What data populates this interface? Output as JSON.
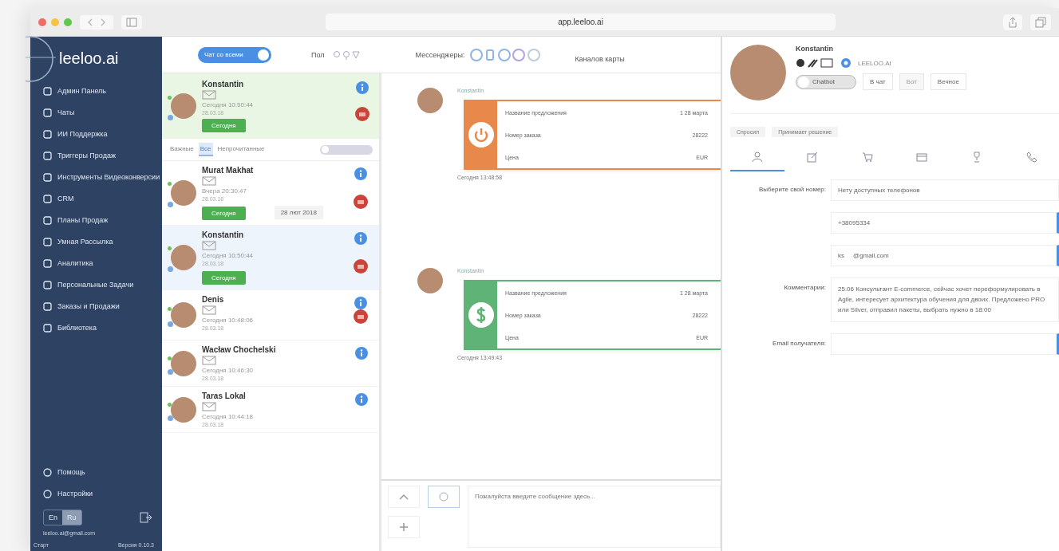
{
  "browser": {
    "address": "app.leeloo.ai"
  },
  "sidebar": {
    "logo": "leeloo.ai",
    "items": [
      {
        "label": "Админ Панель"
      },
      {
        "label": "Чаты"
      },
      {
        "label": "ИИ Поддержка"
      },
      {
        "label": "Триггеры Продаж"
      },
      {
        "label": "Инструменты Видеоконверсии"
      },
      {
        "label": "CRM"
      },
      {
        "label": "Планы Продаж"
      },
      {
        "label": "Умная Рассылка"
      },
      {
        "label": "Аналитика"
      },
      {
        "label": "Персональные Задачи"
      },
      {
        "label": "Заказы и Продажи"
      },
      {
        "label": "Библиотека"
      }
    ],
    "bottom_items": [
      {
        "label": "Помощь"
      },
      {
        "label": "Настройки"
      }
    ],
    "languages": [
      {
        "label": "En",
        "selected": false
      },
      {
        "label": "Ru",
        "selected": true
      }
    ],
    "email": "leeloo.ai@gmail.com",
    "plan": "Старт",
    "version": "Версия 0.10.3"
  },
  "toolbar": {
    "toggle": {
      "label": "Чат со всеми",
      "on": true
    },
    "filter_label": "Пол",
    "messengers_label": "Мессенджеры:",
    "cards_label": "Каналов карты"
  },
  "pinned_chat": {
    "name": "Konstantin",
    "time": "Сегодня 10:50:44",
    "sub": "28.03.18",
    "tag": "Сегодня"
  },
  "filter_tabs": [
    {
      "label": "Важные",
      "selected": false
    },
    {
      "label": "Все",
      "selected": true
    },
    {
      "label": "Непрочитанные",
      "selected": false
    }
  ],
  "filter_toggle": {
    "on": false
  },
  "chats": [
    {
      "name": "Murat Makhat",
      "time": "Вчера 20:30:47",
      "sub": "28.03.18",
      "tag": "Сегодня",
      "date": "28 лют 2018",
      "selected": false,
      "alert": true
    },
    {
      "name": "Konstantin",
      "time": "Сегодня 10:50:44",
      "sub": "28.03.18",
      "tag": "Сегодня",
      "selected": true,
      "alert": true
    },
    {
      "name": "Denis",
      "time": "Сегодня 10:48:06",
      "sub": "28.03.18",
      "selected": false,
      "alert": true
    },
    {
      "name": "Wacław Chochelski",
      "time": "Сегодня 10:46:30",
      "sub": "28.03.18",
      "selected": false,
      "alert": false
    },
    {
      "name": "Taras Lokal",
      "time": "Сегодня 10:44:18",
      "sub": "28.03.18",
      "selected": false,
      "alert": false
    }
  ],
  "messages": [
    {
      "author": "Konstantin",
      "kind": "offer",
      "color": "#e8894b",
      "rows": [
        {
          "label": "Название предложения",
          "value": "1   28 марта"
        },
        {
          "label": "Номер заказа",
          "value": "28222"
        },
        {
          "label": "Цена",
          "value": "EUR"
        }
      ],
      "time": "Сегодня 13:48:58"
    },
    {
      "author": "Konstantin",
      "kind": "payment",
      "color": "#5fb377",
      "rows": [
        {
          "label": "Название предложения",
          "value": "1   28 марта"
        },
        {
          "label": "Номер заказа",
          "value": "28222"
        },
        {
          "label": "Цена",
          "value": "EUR"
        }
      ],
      "time": "Сегодня 13:49:43"
    }
  ],
  "composer": {
    "placeholder": "Пожалуйста введите сообщение здесь..."
  },
  "profile": {
    "name": "Konstantin",
    "status": "LEELOO.AI",
    "toggle": {
      "label": "Chatbot",
      "on": false
    },
    "buttons": [
      {
        "label": "В чат",
        "disabled": false
      },
      {
        "label": "Бот",
        "disabled": true
      },
      {
        "label": "Вечное",
        "disabled": false
      }
    ],
    "tags": [
      "Спросил",
      "Принимает решение"
    ],
    "tabs": [
      {
        "kind": "user",
        "selected": true
      },
      {
        "kind": "edit",
        "selected": false
      },
      {
        "kind": "cart",
        "selected": false
      },
      {
        "kind": "card",
        "selected": false
      },
      {
        "kind": "trophy",
        "selected": false
      },
      {
        "kind": "phone",
        "selected": false
      }
    ],
    "fields": [
      {
        "label": "Выберите свой номер:",
        "kind": "select",
        "value": "Нету доступных телефонов"
      },
      {
        "kind": "input",
        "value": "+38095334"
      },
      {
        "kind": "input",
        "value": "ks     @gmail.com"
      },
      {
        "label": "Комментарии:",
        "kind": "textarea",
        "value": "25.06 Консультант E-commerce, сейчас хочет переформулировать в Agile, интересует архитектура обучения для двоих. Предложено PRO или Silver, отправил пакеты, выбрать нужно в 18:00"
      },
      {
        "label": "Email получателя:",
        "kind": "input"
      }
    ]
  }
}
